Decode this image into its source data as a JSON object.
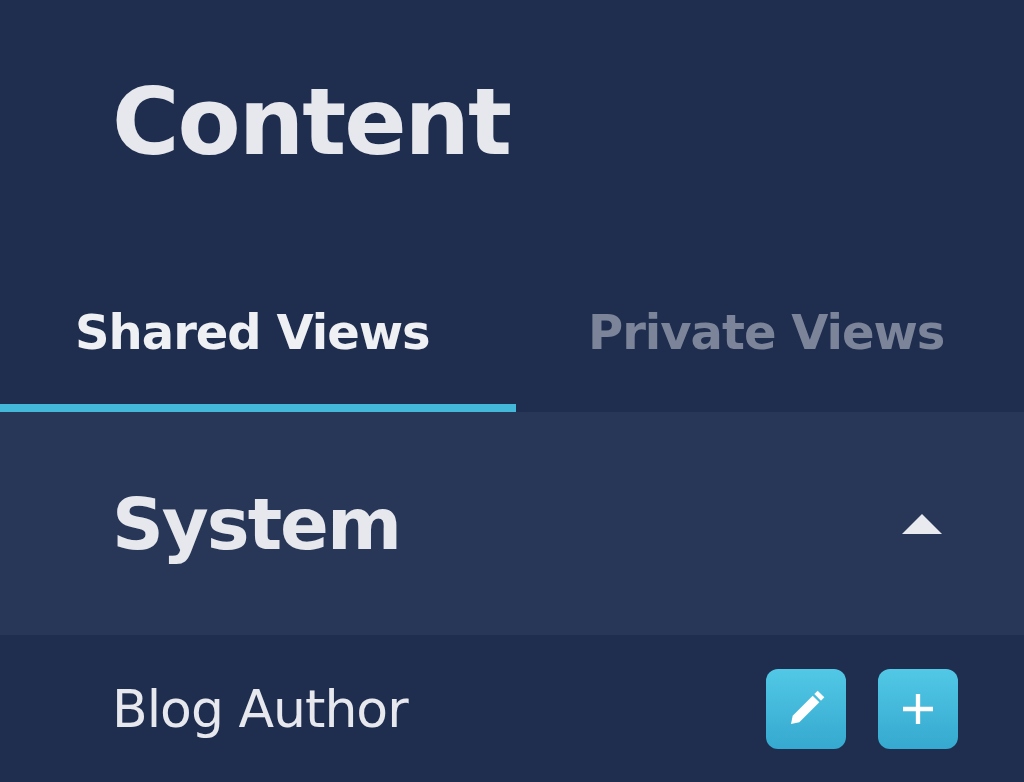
{
  "title": "Content",
  "tabs": [
    {
      "label": "Shared Views",
      "selected": true
    },
    {
      "label": "Private Views",
      "selected": false
    }
  ],
  "sections": [
    {
      "title": "System",
      "expanded": true,
      "items": [
        {
          "label": "Blog Author"
        }
      ]
    }
  ]
}
